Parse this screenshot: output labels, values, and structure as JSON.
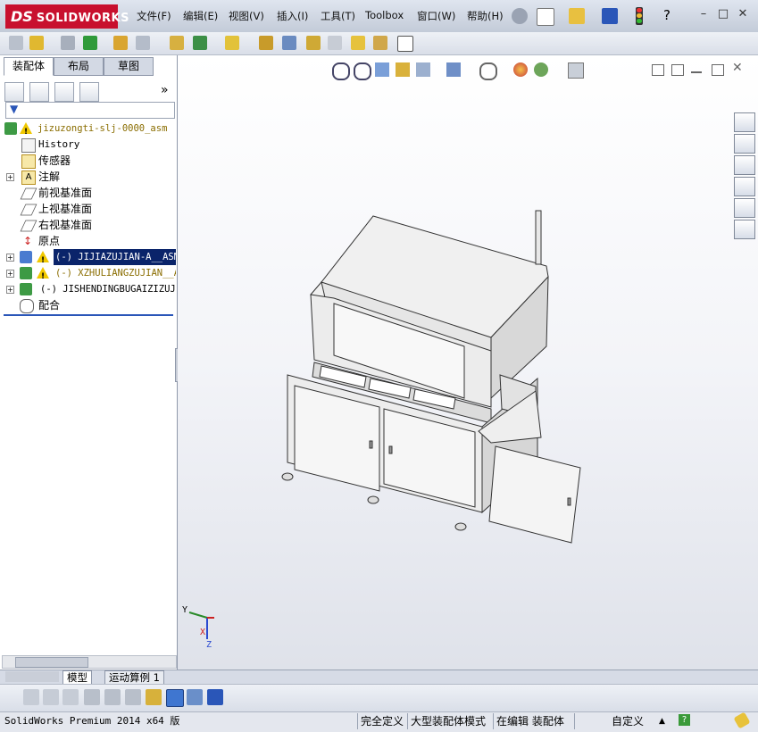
{
  "app": {
    "logo_ds": "DS",
    "logo_name": "SOLIDWORKS"
  },
  "menu": [
    {
      "label": "文件(F)"
    },
    {
      "label": "编辑(E)"
    },
    {
      "label": "视图(V)"
    },
    {
      "label": "插入(I)"
    },
    {
      "label": "工具(T)"
    },
    {
      "label": "Toolbox"
    },
    {
      "label": "窗口(W)"
    },
    {
      "label": "帮助(H)"
    }
  ],
  "panel_tabs": [
    {
      "label": "装配体"
    },
    {
      "label": "布局"
    },
    {
      "label": "草图"
    }
  ],
  "panel_more": "»",
  "tree": [
    {
      "label": "jizuzongti-slj-0000_asm",
      "expander": "",
      "warning": true
    },
    {
      "label": "History",
      "expander": "",
      "warning": false
    },
    {
      "label": "传感器",
      "expander": "",
      "warning": false
    },
    {
      "label": "注解",
      "expander": "+",
      "warning": false
    },
    {
      "label": "前视基准面",
      "expander": "",
      "warning": false
    },
    {
      "label": "上视基准面",
      "expander": "",
      "warning": false
    },
    {
      "label": "右视基准面",
      "expander": "",
      "warning": false
    },
    {
      "label": "原点",
      "expander": "",
      "warning": false
    },
    {
      "label": "(-) JIJIAZUJIAN-A__ASM<",
      "expander": "+",
      "warning": true
    },
    {
      "label": "(-) XZHULIANGZUJIAN__AS",
      "expander": "+",
      "warning": true
    },
    {
      "label": "(-) JISHENDINGBUGAIZIZUJIA",
      "expander": "+",
      "warning": false
    },
    {
      "label": "配合",
      "expander": "",
      "warning": false
    }
  ],
  "bottom_tabs": [
    {
      "label": "模型"
    },
    {
      "label": "运动算例 1"
    }
  ],
  "triad": {
    "y": "Y",
    "x": "X",
    "z": "Z"
  },
  "status": {
    "product": "SolidWorks Premium 2014 x64 版",
    "defined": "完全定义",
    "mode": "大型装配体模式",
    "editing": "在编辑 装配体",
    "custom": "自定义"
  },
  "colors": {
    "accent_red": "#c8102e",
    "selection_blue": "#0a246a",
    "warning_yellow": "#f0c800"
  }
}
